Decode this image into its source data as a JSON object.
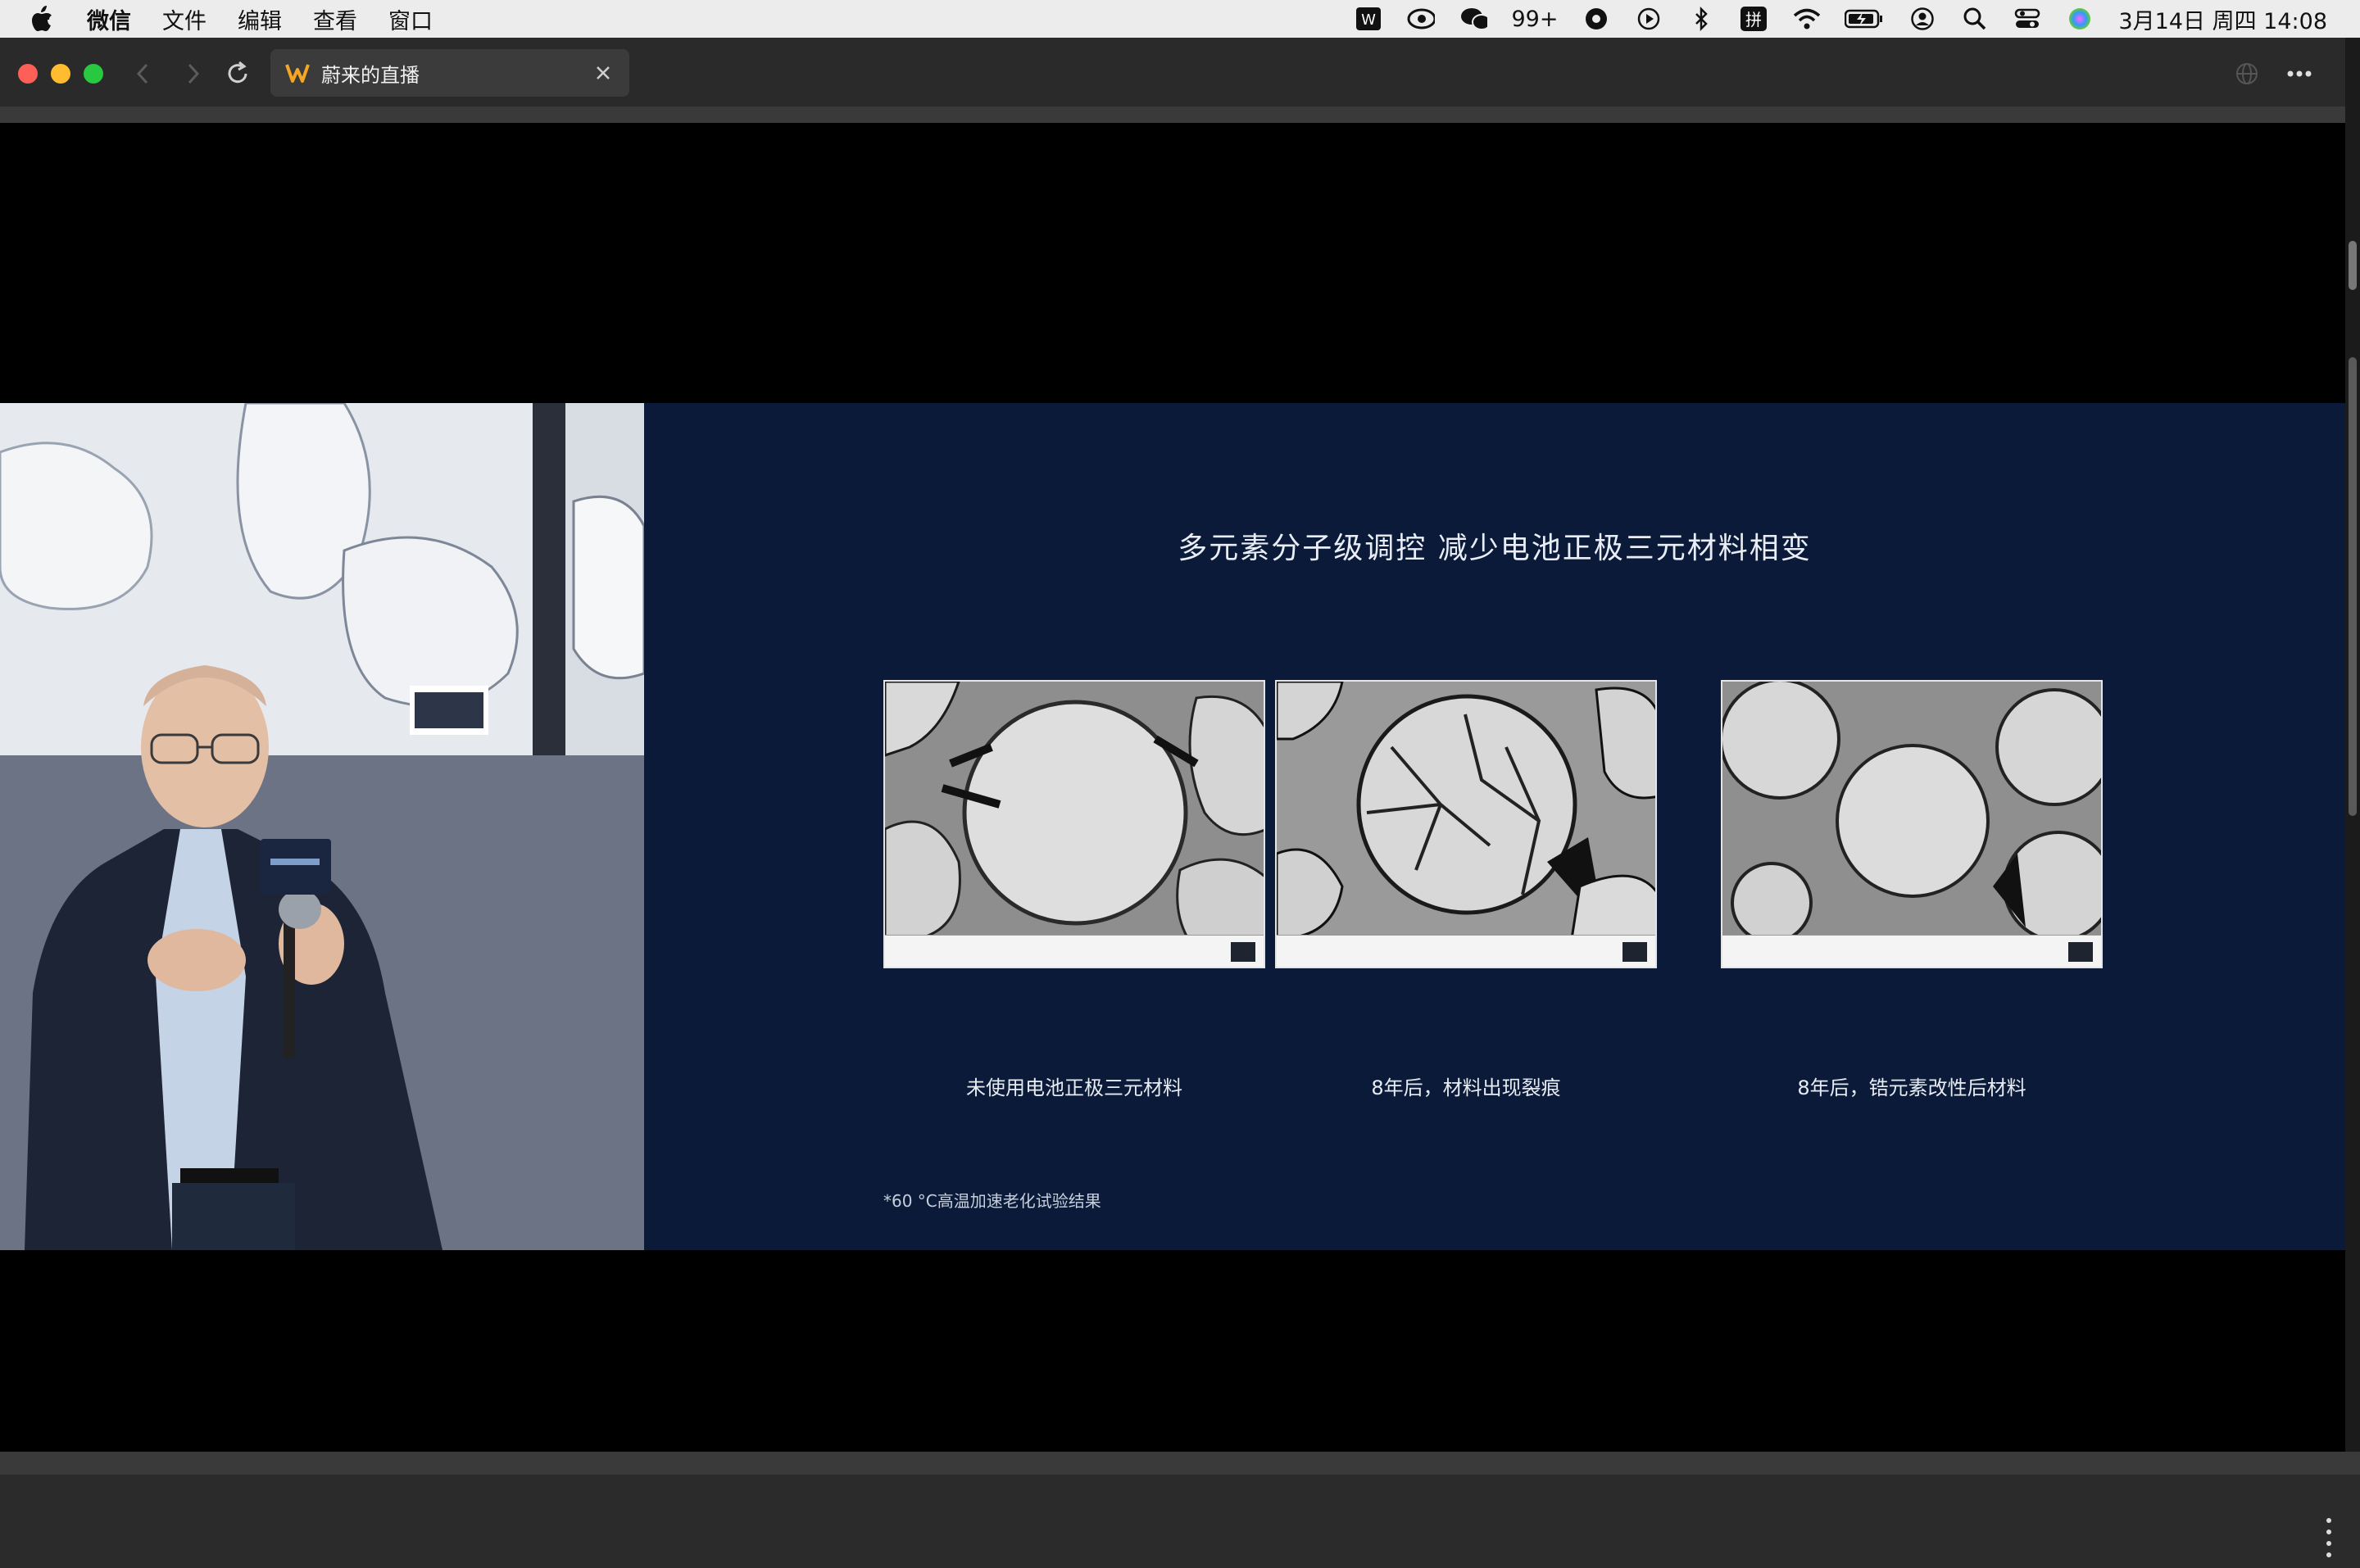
{
  "menubar": {
    "app_name": "微信",
    "items": [
      "文件",
      "编辑",
      "查看",
      "窗口"
    ],
    "status": {
      "badge_count": "99+",
      "input_method": "拼",
      "datetime": "3月14日 周四 14:08"
    }
  },
  "browser": {
    "tab_title": "蔚来的直播"
  },
  "slide": {
    "title": "多元素分子级调控 减少电池正极三元材料相变",
    "captions": [
      "未使用电池正极三元材料",
      "8年后，材料出现裂痕",
      "8年后，锆元素改性后材料"
    ],
    "footnote": "*60 °C高温加速老化试验结果"
  },
  "colors": {
    "slide_bg": "#0a1a38",
    "titlebar_bg": "#2a2a2a",
    "menubar_bg": "#ececec"
  }
}
